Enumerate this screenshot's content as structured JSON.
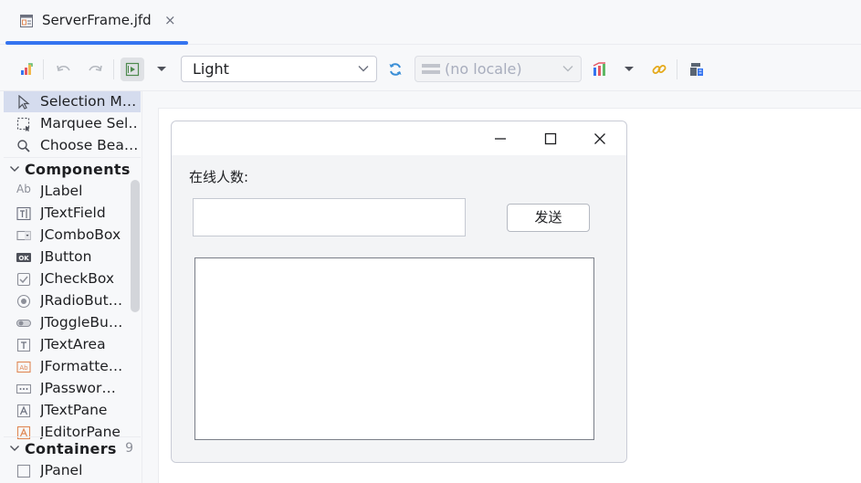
{
  "tab": {
    "title": "ServerFrame.jfd",
    "close": "×"
  },
  "toolbar": {
    "theme": "Light",
    "locale_placeholder": "(no locale)"
  },
  "palette": {
    "tools": [
      {
        "label": "Selection M…"
      },
      {
        "label": "Marquee Sel…"
      },
      {
        "label": "Choose Bea…"
      }
    ],
    "components_header": "Components",
    "components": [
      {
        "label": "JLabel"
      },
      {
        "label": "JTextField"
      },
      {
        "label": "JComboBox"
      },
      {
        "label": "JButton"
      },
      {
        "label": "JCheckBox"
      },
      {
        "label": "JRadioBut…"
      },
      {
        "label": "JToggleBu…"
      },
      {
        "label": "JTextArea"
      },
      {
        "label": "JFormatte…"
      },
      {
        "label": "JPasswor…"
      },
      {
        "label": "JTextPane"
      },
      {
        "label": "JEditorPane"
      }
    ],
    "containers_header": "Containers",
    "containers_count": "9",
    "containers": [
      {
        "label": "JPanel"
      }
    ]
  },
  "form": {
    "online_label": "在线人数:",
    "send_button": "发送"
  }
}
